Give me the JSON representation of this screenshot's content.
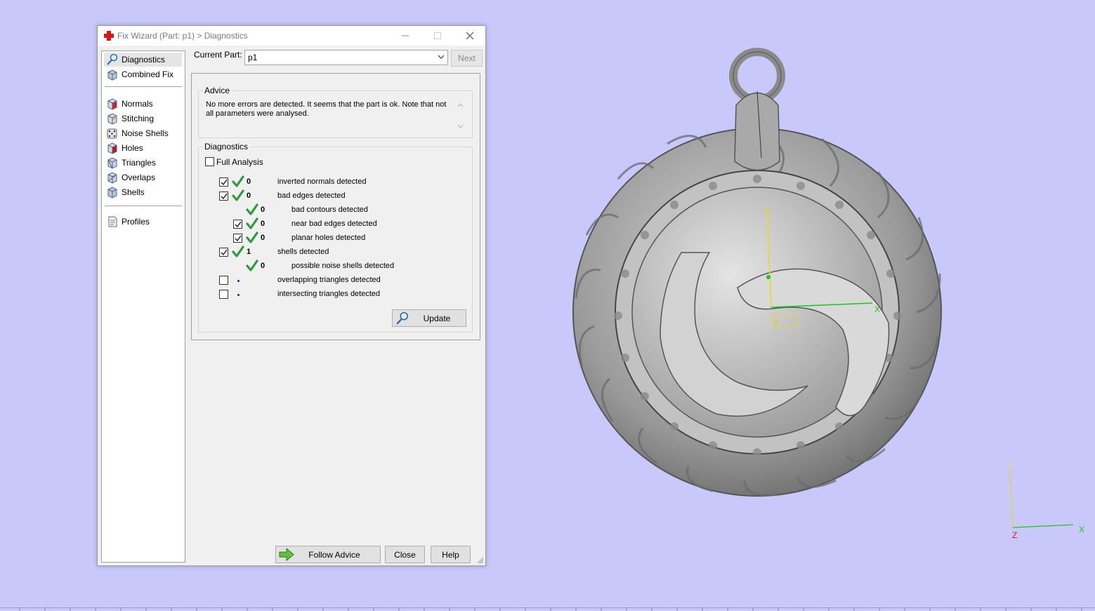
{
  "window": {
    "title": "Fix Wizard (Part: p1) > Diagnostics",
    "icon": "red-cross-icon"
  },
  "nav": {
    "items": [
      {
        "label": "Diagnostics",
        "icon": "magnifier-icon",
        "selected": true
      },
      {
        "label": "Combined Fix",
        "icon": "cube-stack-icon"
      },
      {
        "label": "Normals",
        "icon": "cube-red-icon"
      },
      {
        "label": "Stitching",
        "icon": "cube-stitch-icon"
      },
      {
        "label": "Noise Shells",
        "icon": "dice-icon"
      },
      {
        "label": "Holes",
        "icon": "cube-holes-icon"
      },
      {
        "label": "Triangles",
        "icon": "triangle-cube-icon"
      },
      {
        "label": "Overlaps",
        "icon": "overlap-cube-icon"
      },
      {
        "label": "Shells",
        "icon": "shell-cube-icon"
      },
      {
        "label": "Profiles",
        "icon": "document-icon"
      }
    ]
  },
  "top": {
    "current_part_label": "Current Part:",
    "current_part_value": "p1",
    "next_label": "Next"
  },
  "advice": {
    "legend": "Advice",
    "text": "No more errors are detected. It seems that the part is ok. Note that not all parameters were analysed."
  },
  "diagnostics": {
    "legend": "Diagnostics",
    "full_analysis_label": "Full Analysis",
    "full_analysis_checked": false,
    "rows": [
      {
        "checked": true,
        "status": "ok",
        "count": "0",
        "label": "inverted normals detected"
      },
      {
        "checked": true,
        "status": "ok",
        "count": "0",
        "label": "bad edges detected"
      },
      {
        "checked": null,
        "status": "ok",
        "count": "0",
        "label": "bad contours detected"
      },
      {
        "checked": true,
        "status": "ok",
        "count": "0",
        "label": "near bad edges detected"
      },
      {
        "checked": true,
        "status": "ok",
        "count": "0",
        "label": "planar holes detected"
      },
      {
        "checked": true,
        "status": "ok",
        "count": "1",
        "label": "shells detected"
      },
      {
        "checked": null,
        "status": "ok",
        "count": "0",
        "label": "possible noise shells detected"
      },
      {
        "checked": false,
        "status": "not-analysed",
        "count": "",
        "label": "overlapping triangles detected"
      },
      {
        "checked": false,
        "status": "not-analysed",
        "count": "",
        "label": "intersecting triangles detected"
      }
    ],
    "update_label": "Update"
  },
  "footer": {
    "follow_advice_label": "Follow Advice",
    "close_label": "Close",
    "help_label": "Help"
  },
  "viewport": {
    "background": "#c9c8fb",
    "model_axis_x": "X",
    "model_axis_y": "Y",
    "model_axis_z": "Z",
    "corner_axis_x": "X",
    "corner_axis_y": "Y",
    "corner_axis_z": "Z"
  },
  "colors": {
    "check_green": "#2e9a3c",
    "cross_red": "#d41818",
    "axis_x": "#18c818",
    "axis_y": "#e8d820"
  }
}
